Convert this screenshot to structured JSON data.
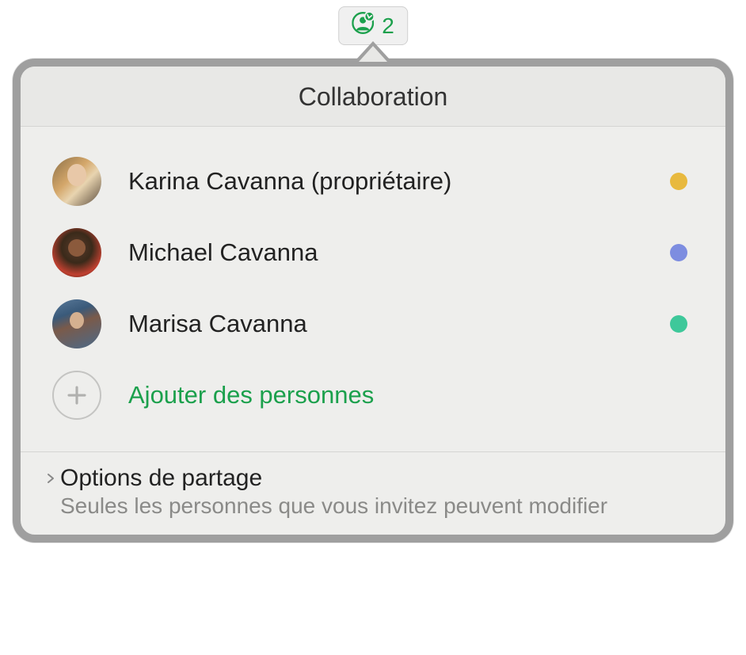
{
  "toolbar": {
    "participant_count": "2",
    "accent_color": "#1ba04c"
  },
  "popover": {
    "title": "Collaboration",
    "participants": [
      {
        "name": "Karina Cavanna (propriétaire)",
        "status_color": "#e8b93e"
      },
      {
        "name": "Michael Cavanna",
        "status_color": "#7d8de0"
      },
      {
        "name": "Marisa Cavanna",
        "status_color": "#3ec89a"
      }
    ],
    "add_people_label": "Ajouter des personnes",
    "share_options": {
      "title": "Options de partage",
      "subtitle": "Seules les personnes que vous invitez peuvent modifier"
    }
  }
}
